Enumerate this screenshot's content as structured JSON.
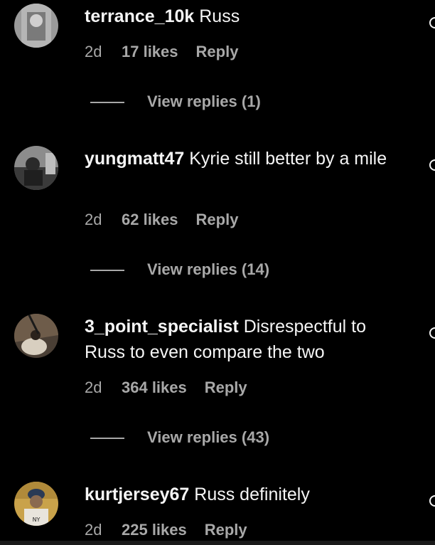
{
  "comments": [
    {
      "username": "terrance_10k",
      "text": " Russ",
      "age": "2d",
      "likes": "17 likes",
      "reply": "Reply",
      "view_replies": "View replies (1)",
      "avatar_color": "#8a8a8a"
    },
    {
      "username": "yungmatt47",
      "text": " Kyrie still better by a mile",
      "age": "2d",
      "likes": "62 likes",
      "reply": "Reply",
      "view_replies": "View replies (14)",
      "avatar_color": "#6b6b6b"
    },
    {
      "username": "3_point_specialist",
      "text": " Disrespectful to Russ to even compare the two",
      "age": "2d",
      "likes": "364 likes",
      "reply": "Reply",
      "view_replies": "View replies (43)",
      "avatar_color": "#5a4a3a"
    },
    {
      "username": "kurtjersey67",
      "text": " Russ definitely",
      "age": "2d",
      "likes": "225 likes",
      "reply": "Reply",
      "avatar_color": "#c9a24a"
    }
  ],
  "icons": {
    "like": "heart-outline-icon"
  }
}
